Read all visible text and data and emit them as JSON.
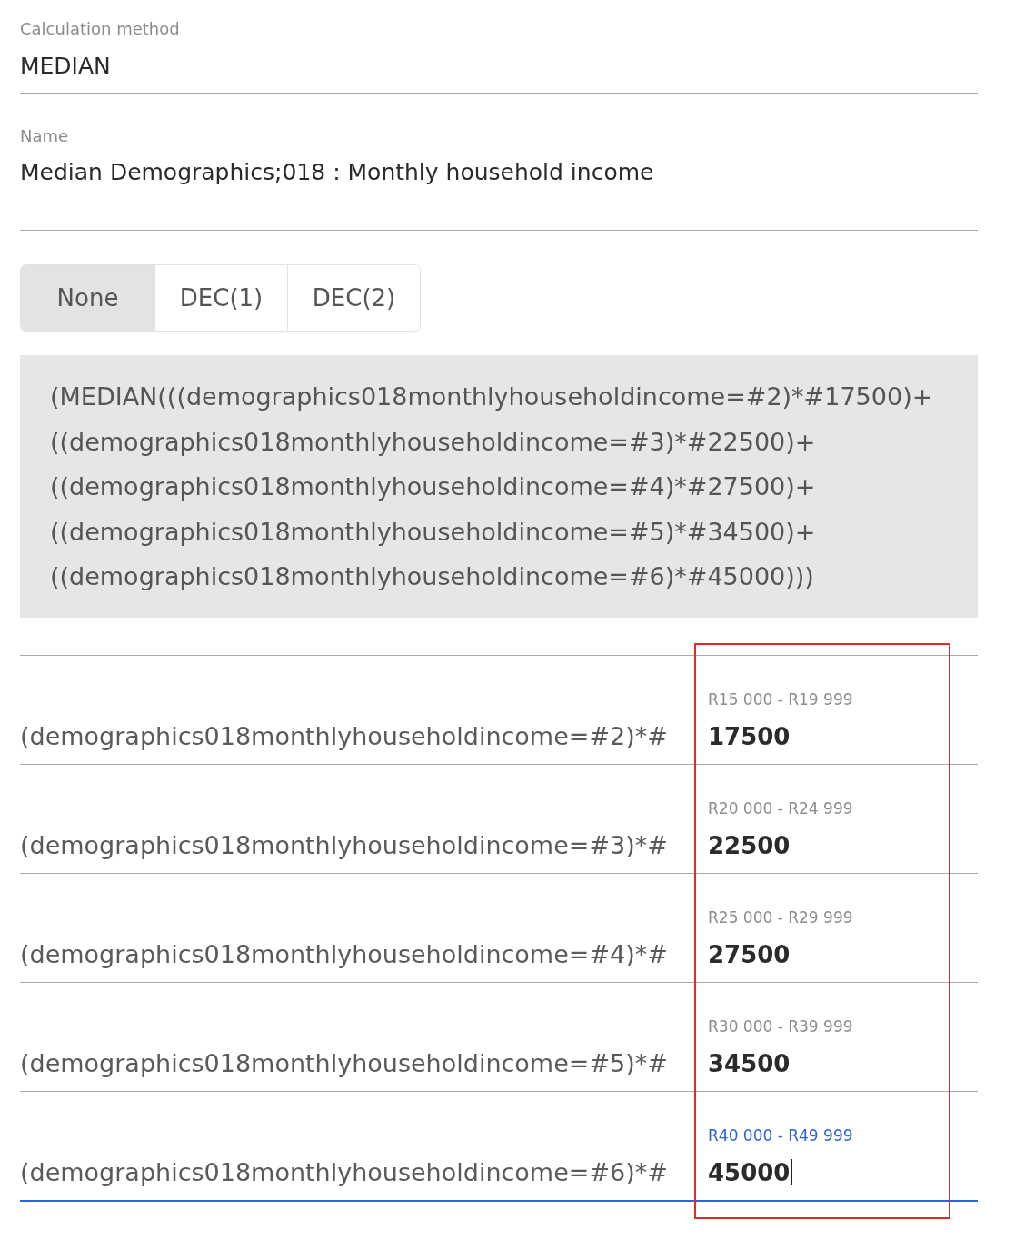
{
  "fields": [
    {
      "label": "Calculation method",
      "value": "MEDIAN"
    },
    {
      "label": "Name",
      "value": "Median Demographics;018 : Monthly household income"
    }
  ],
  "decimals": {
    "options": [
      {
        "label": "None",
        "selected": true
      },
      {
        "label": "DEC(1)",
        "selected": false
      },
      {
        "label": "DEC(2)",
        "selected": false
      }
    ]
  },
  "formula": {
    "lines": [
      "(MEDIAN(((demographics018monthlyhouseholdincome=#2)*#17500)+",
      "((demographics018monthlyhouseholdincome=#3)*#22500)+",
      "((demographics018monthlyhouseholdincome=#4)*#27500)+",
      "((demographics018monthlyhouseholdincome=#5)*#34500)+",
      "((demographics018monthlyhouseholdincome=#6)*#45000)))"
    ]
  },
  "rows": [
    {
      "prefix": "(demographics018monthlyhouseholdincome=#2)*#",
      "label": "R15 000 - R19 999",
      "value": "17500",
      "focused": false
    },
    {
      "prefix": "(demographics018monthlyhouseholdincome=#3)*#",
      "label": "R20 000 - R24 999",
      "value": "22500",
      "focused": false
    },
    {
      "prefix": "(demographics018monthlyhouseholdincome=#4)*#",
      "label": "R25 000 - R29 999",
      "value": "27500",
      "focused": false
    },
    {
      "prefix": "(demographics018monthlyhouseholdincome=#5)*#",
      "label": "R30 000 - R39 999",
      "value": "34500",
      "focused": false
    },
    {
      "prefix": "(demographics018monthlyhouseholdincome=#6)*#",
      "label": "R40 000 - R49 999",
      "value": "45000",
      "focused": true
    }
  ],
  "annotations": [
    {
      "kind": "rectangle"
    }
  ]
}
